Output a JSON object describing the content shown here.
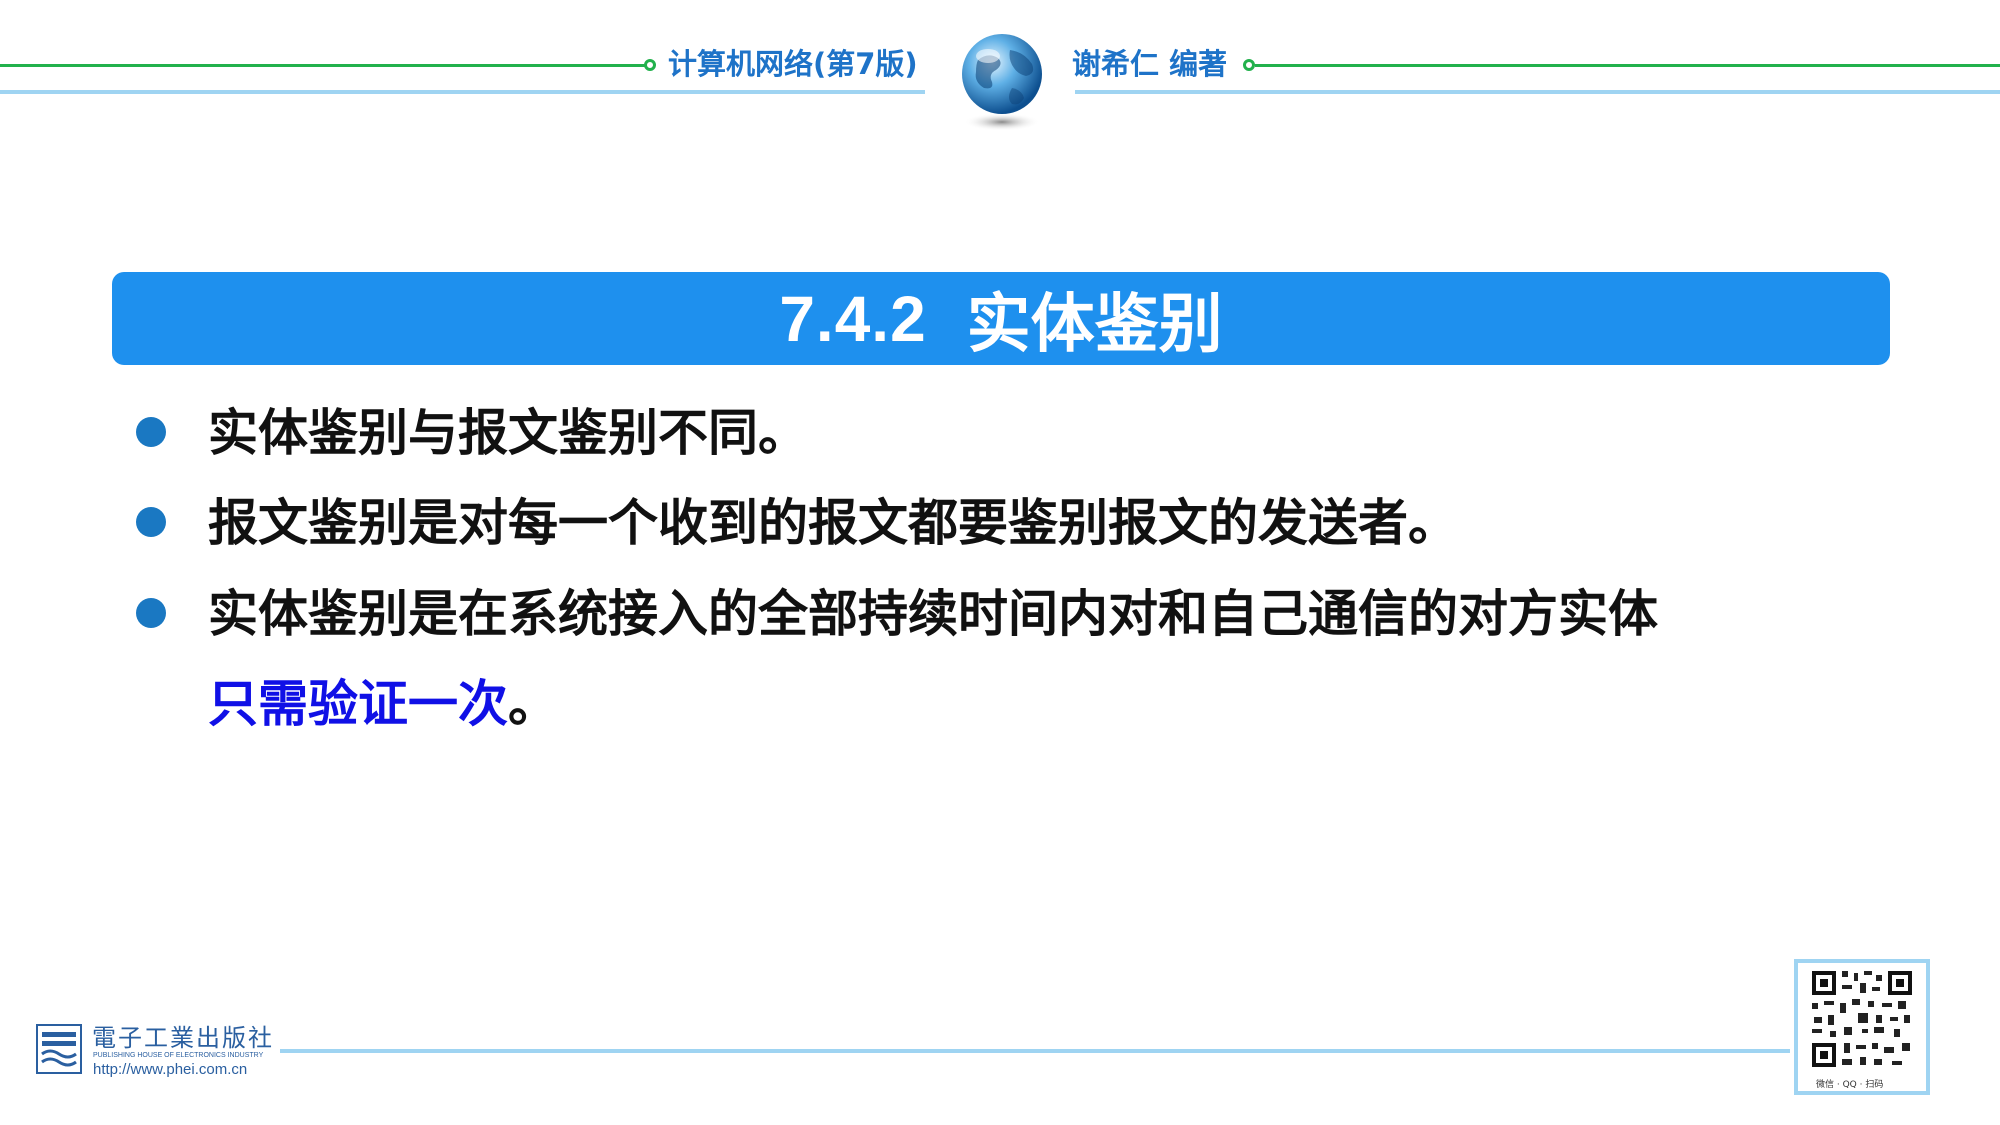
{
  "header": {
    "book_title": "计算机网络(第7版)",
    "author": "谢希仁 编著",
    "globe_icon": "globe-icon"
  },
  "banner": {
    "section_number": "7.4.2",
    "section_title": "实体鉴别"
  },
  "bullets": [
    {
      "text": "实体鉴别与报文鉴别不同。"
    },
    {
      "text": "报文鉴别是对每一个收到的报文都要鉴别报文的发送者。"
    },
    {
      "text_line1": "实体鉴别是在系统接入的全部持续时间内对和自己通信的对方实体",
      "text_line2_highlight": "只需验证一次",
      "text_line2_tail": "。"
    }
  ],
  "footer": {
    "publisher_cn": "電子工業出版社",
    "publisher_en": "PUBLISHING HOUSE OF ELECTRONICS INDUSTRY",
    "publisher_url": "http://www.phei.com.cn",
    "qr_caption": "微信 · QQ · 扫码"
  },
  "colors": {
    "banner": "#1e90ee",
    "highlight": "#1010e6",
    "header_text": "#1e73c8",
    "header_green": "#22b14c",
    "header_blue": "#9fd4f2",
    "bullet": "#1a78c2"
  }
}
